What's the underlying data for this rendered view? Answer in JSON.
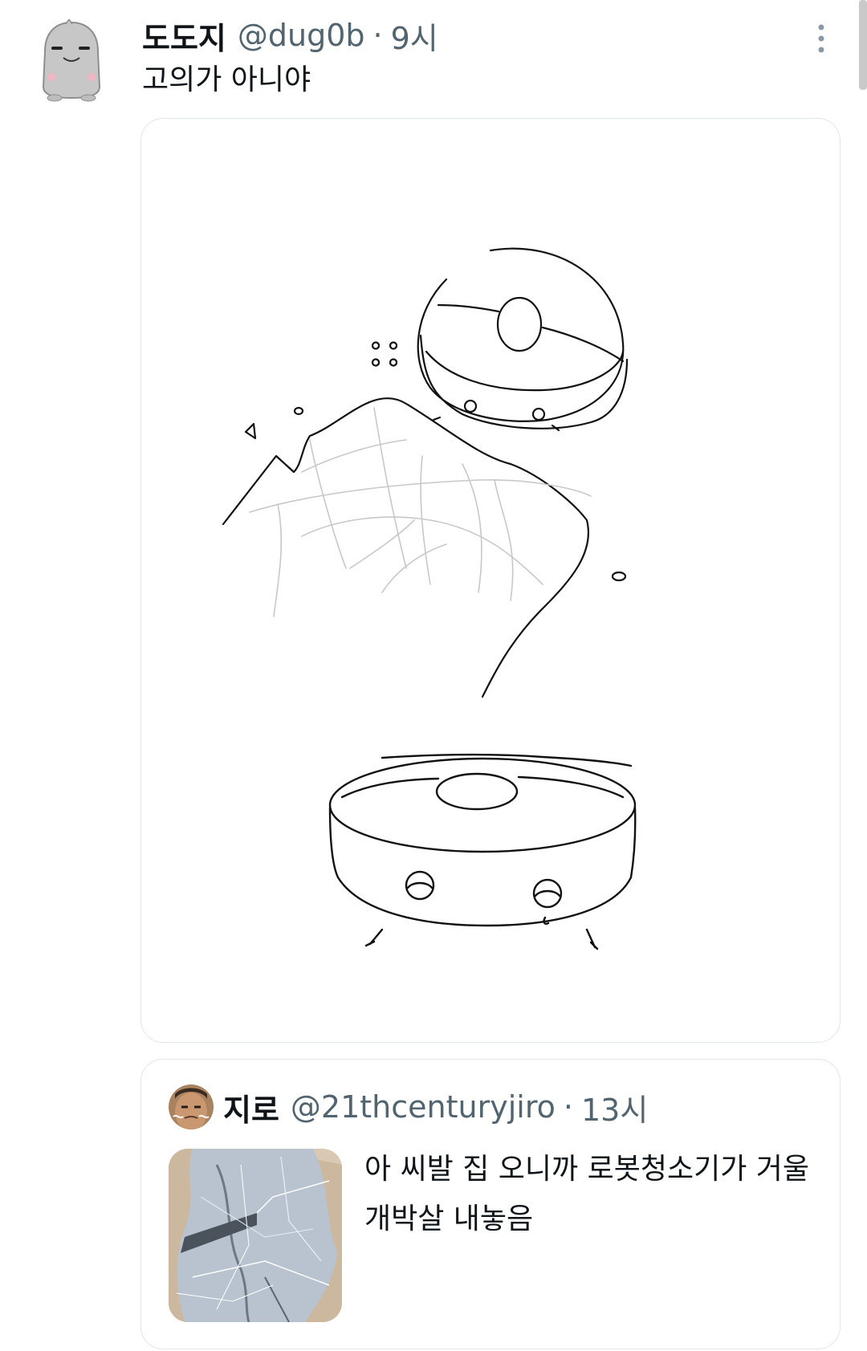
{
  "tweet": {
    "display_name": "도도지",
    "handle": "@dug0b",
    "separator": "·",
    "time": "9시",
    "text": "고의가 아니야",
    "avatar_icon": "gray-creature-avatar",
    "more_icon": "more-options-icon"
  },
  "quoted_tweet": {
    "display_name": "지로",
    "handle": "@21thcenturyjiro",
    "separator": "·",
    "time": "13시",
    "text": "아 씨발 집 오니까 로봇청소기가 거울 개박살 내놓음",
    "avatar_icon": "user-photo-avatar",
    "thumbnail": "broken-mirror-photo"
  },
  "colors": {
    "primary_text": "#0f1419",
    "secondary_text": "#536471",
    "border": "#e1e6ea"
  }
}
